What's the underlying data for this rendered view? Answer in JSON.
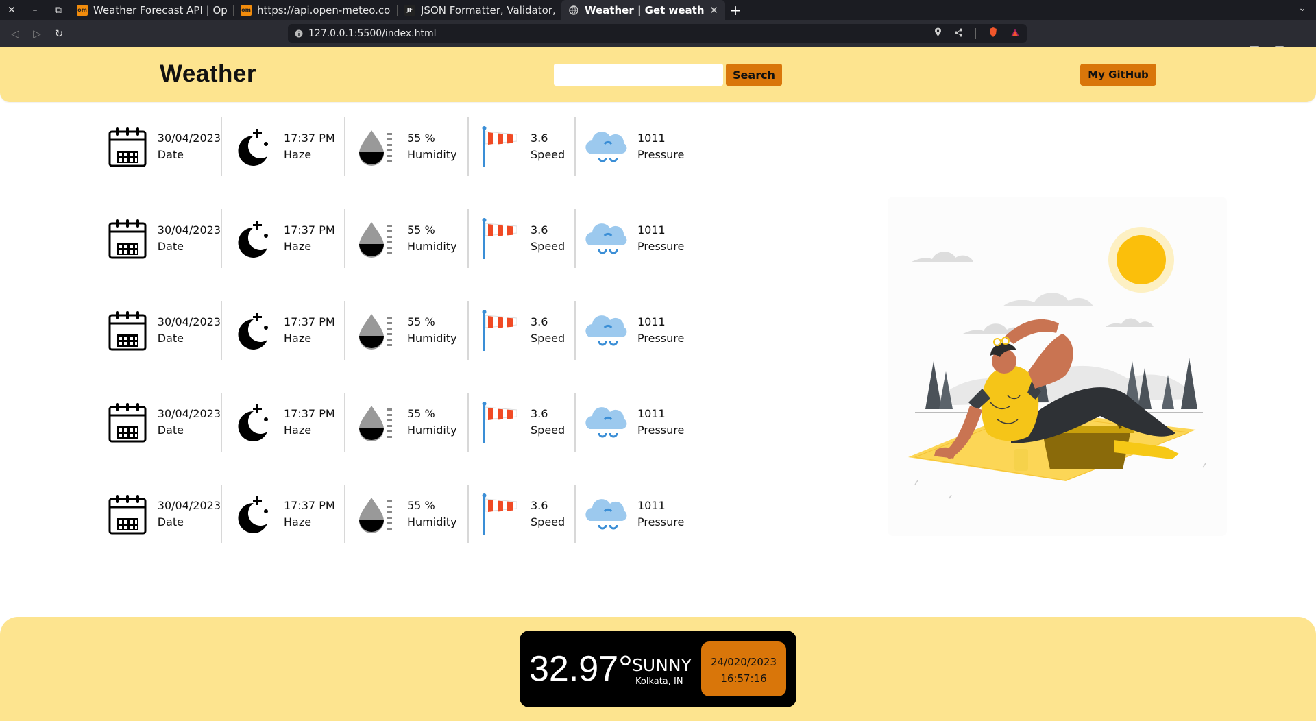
{
  "browser": {
    "tabs": [
      {
        "favicon": "om",
        "title": "Weather Forecast API | Open-"
      },
      {
        "favicon": "om",
        "title": "https://api.open-meteo.com/"
      },
      {
        "favicon": "JF",
        "title": "JSON Formatter, Validator, V"
      },
      {
        "favicon": "globe-icon",
        "title": "Weather | Get weather of"
      }
    ],
    "url": "127.0.0.1:5500/index.html"
  },
  "header": {
    "brand": "Weather",
    "search_placeholder": "",
    "search_label": "Search",
    "github_label": "My GitHub"
  },
  "forecast": [
    {
      "date": "30/04/2023",
      "date_label": "Date",
      "time": "17:37 PM",
      "condition": "Haze",
      "humidity": "55 %",
      "humidity_label": "Humidity",
      "wind": "3.6",
      "wind_label": "Speed",
      "pressure": "1011",
      "pressure_label": "Pressure"
    },
    {
      "date": "30/04/2023",
      "date_label": "Date",
      "time": "17:37 PM",
      "condition": "Haze",
      "humidity": "55 %",
      "humidity_label": "Humidity",
      "wind": "3.6",
      "wind_label": "Speed",
      "pressure": "1011",
      "pressure_label": "Pressure"
    },
    {
      "date": "30/04/2023",
      "date_label": "Date",
      "time": "17:37 PM",
      "condition": "Haze",
      "humidity": "55 %",
      "humidity_label": "Humidity",
      "wind": "3.6",
      "wind_label": "Speed",
      "pressure": "1011",
      "pressure_label": "Pressure"
    },
    {
      "date": "30/04/2023",
      "date_label": "Date",
      "time": "17:37 PM",
      "condition": "Haze",
      "humidity": "55 %",
      "humidity_label": "Humidity",
      "wind": "3.6",
      "wind_label": "Speed",
      "pressure": "1011",
      "pressure_label": "Pressure"
    },
    {
      "date": "30/04/2023",
      "date_label": "Date",
      "time": "17:37 PM",
      "condition": "Haze",
      "humidity": "55 %",
      "humidity_label": "Humidity",
      "wind": "3.6",
      "wind_label": "Speed",
      "pressure": "1011",
      "pressure_label": "Pressure"
    }
  ],
  "current": {
    "temperature": "32.97°",
    "condition": "SUNNY",
    "location": "Kolkata, IN",
    "date": "24/020/2023",
    "time": "16:57:16"
  },
  "colors": {
    "accent_yellow": "#fde48f",
    "accent_orange": "#d9760a",
    "sun": "#fbbf0b",
    "wind_sock_red": "#f04a24",
    "cloud_blue": "#9cc9ee"
  }
}
